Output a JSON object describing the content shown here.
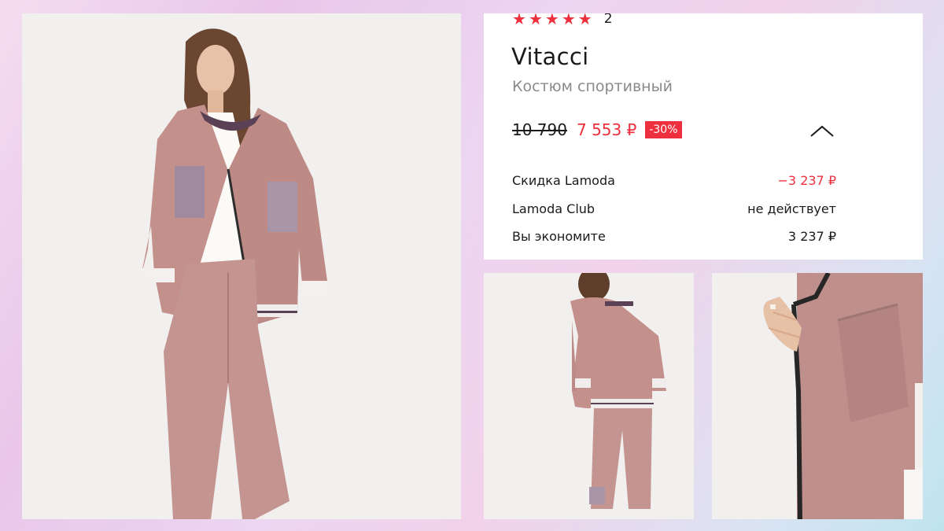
{
  "product": {
    "rating_count": "2",
    "rating_stars": 5,
    "brand": "Vitacci",
    "type": "Костюм спортивный",
    "old_price": "10 790",
    "new_price": "7 553 ₽",
    "discount": "-30%"
  },
  "price_details": [
    {
      "label": "Скидка Lamoda",
      "value": "−3 237 ₽"
    },
    {
      "label": "Lamoda Club",
      "value": "не действует"
    },
    {
      "label": "Вы экономите",
      "value": "3 237 ₽"
    }
  ],
  "icons": {
    "star": "star-icon",
    "expand": "chevron-up-icon"
  },
  "colors": {
    "accent_red": "#ee2f3d",
    "suit_pink": "#c3918f"
  }
}
